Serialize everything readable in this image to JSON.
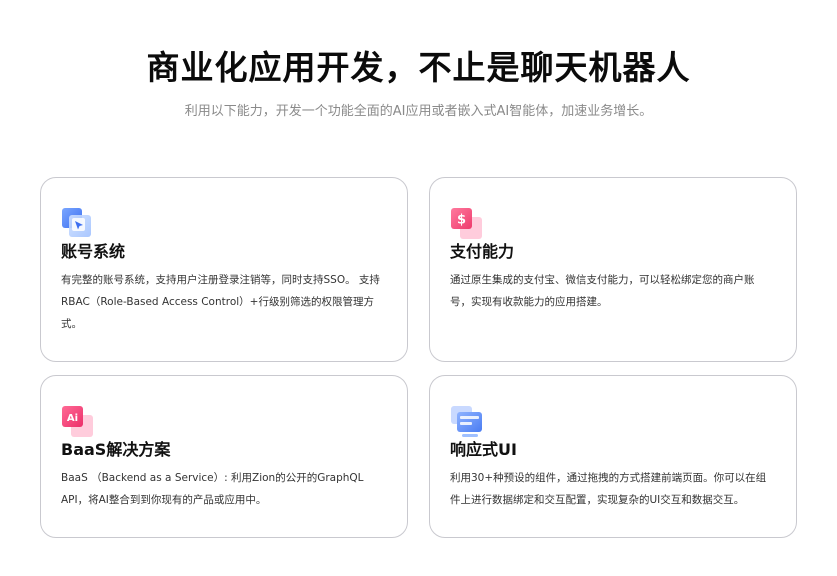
{
  "hero": {
    "title": "商业化应用开发，不止是聊天机器人",
    "subtitle": "利用以下能力，开发一个功能全面的AI应用或者嵌入式AI智能体，加速业务增长。"
  },
  "features": [
    {
      "icon": "account-icon",
      "title": "账号系统",
      "description": "有完整的账号系统，支持用户注册登录注销等，同时支持SSO。 支持RBAC（Role-Based Access Control）+行级别筛选的权限管理方式。"
    },
    {
      "icon": "payment-icon",
      "title": "支付能力",
      "description": "通过原生集成的支付宝、微信支付能力，可以轻松绑定您的商户账号，实现有收款能力的应用搭建。"
    },
    {
      "icon": "ai-icon",
      "title": "BaaS解决方案",
      "description": "BaaS （Backend as a Service）: 利用Zion的公开的GraphQL API，将AI整合到到你现有的产品或应用中。"
    },
    {
      "icon": "responsive-ui-icon",
      "title": "响应式UI",
      "description": "利用30+种预设的组件，通过拖拽的方式搭建前端页面。你可以在组件上进行数据绑定和交互配置，实现复杂的UI交互和数据交互。"
    }
  ],
  "colors": {
    "card_border": "#c9c9cf",
    "subtitle_text": "#8a8a8a",
    "icon_blue": "#4a7cf2",
    "icon_pink": "#f0457a"
  }
}
